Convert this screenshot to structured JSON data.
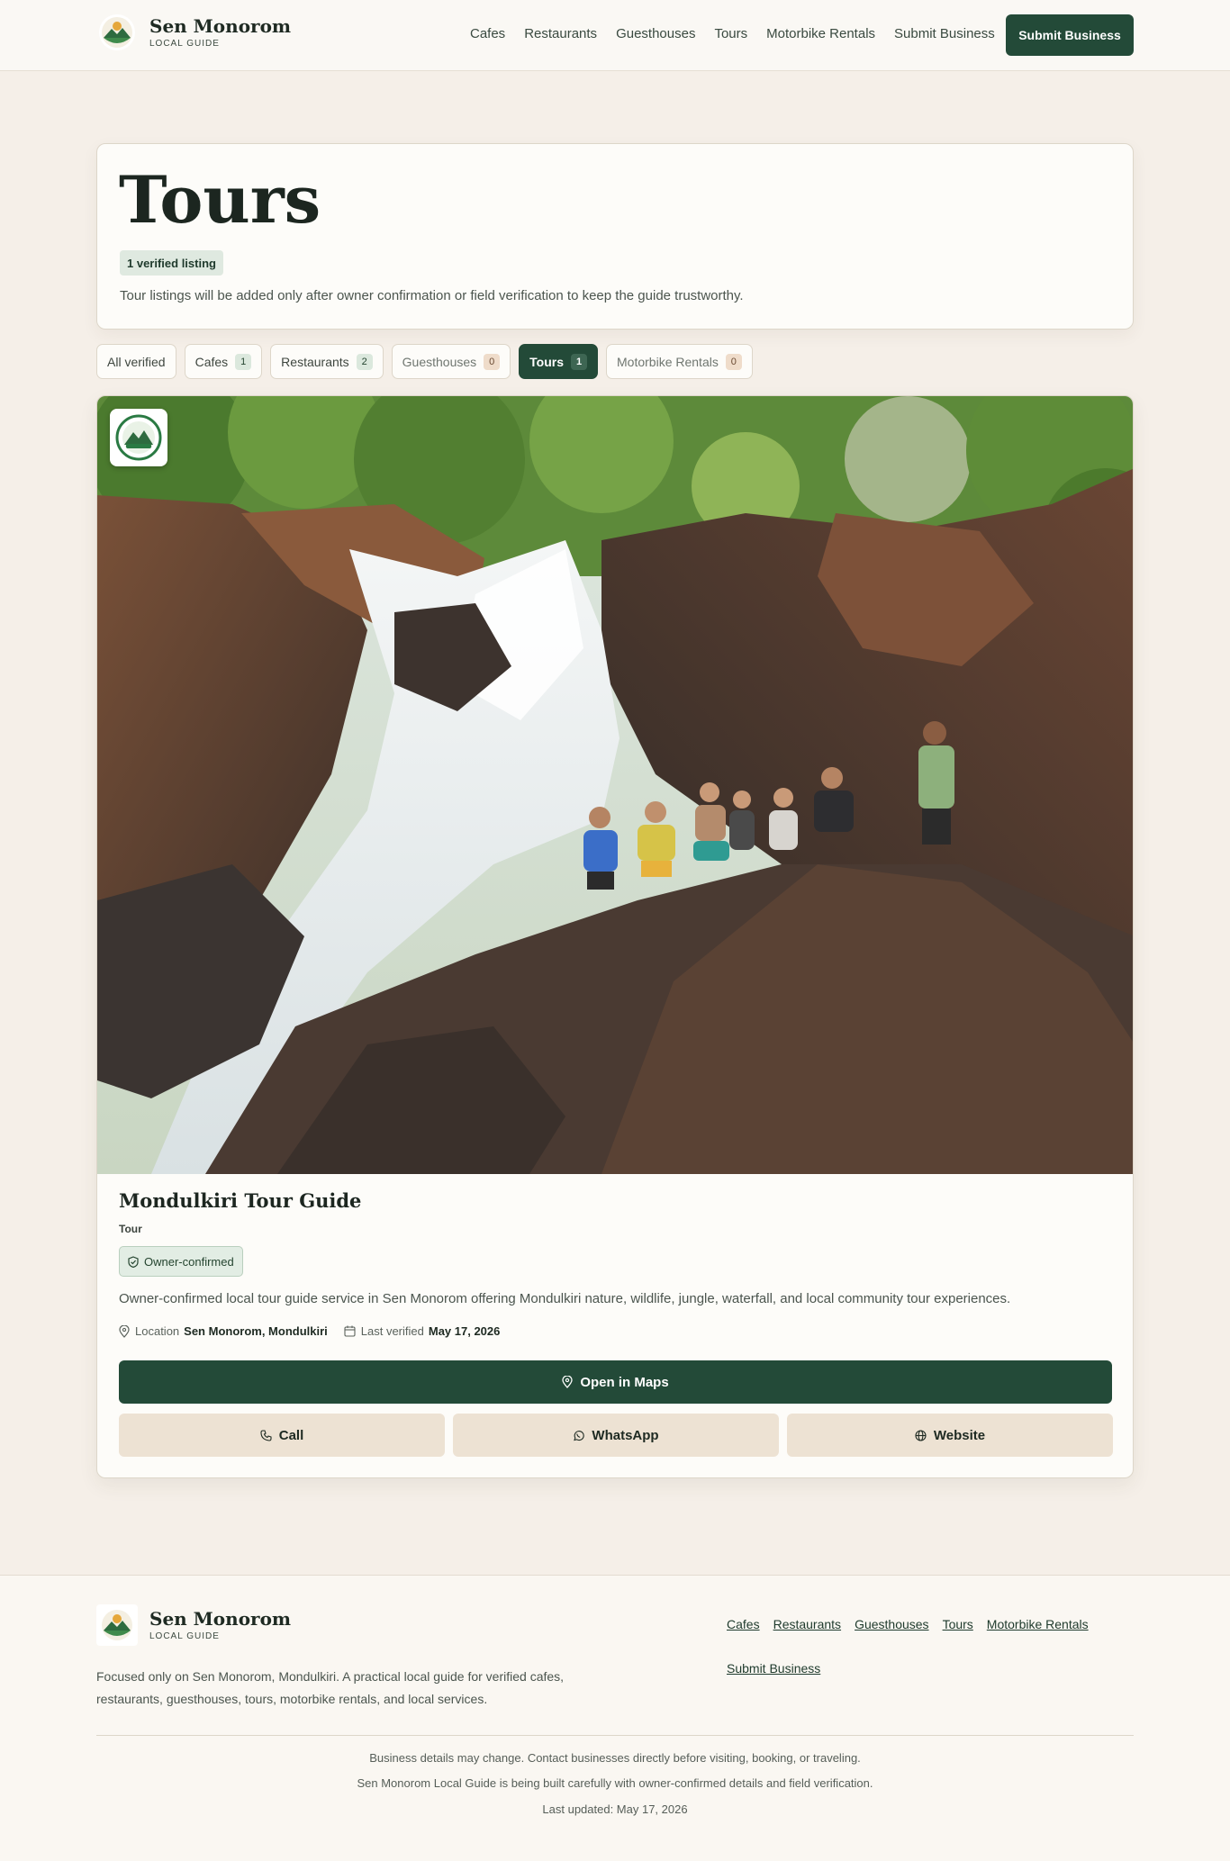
{
  "header": {
    "brand_name": "Sen Monorom",
    "brand_sub": "LOCAL GUIDE",
    "nav": [
      "Cafes",
      "Restaurants",
      "Guesthouses",
      "Tours",
      "Motorbike Rentals",
      "Submit Business"
    ],
    "submit_button": "Submit Business"
  },
  "hero": {
    "title": "Tours",
    "badge": "1 verified listing",
    "description": "Tour listings will be added only after owner confirmation or field verification to keep the guide trustworthy."
  },
  "filters": [
    {
      "label": "All verified",
      "count": null
    },
    {
      "label": "Cafes",
      "count": "1"
    },
    {
      "label": "Restaurants",
      "count": "2"
    },
    {
      "label": "Guesthouses",
      "count": "0"
    },
    {
      "label": "Tours",
      "count": "1"
    },
    {
      "label": "Motorbike Rentals",
      "count": "0"
    }
  ],
  "listing": {
    "title": "Mondulkiri Tour Guide",
    "type": "Tour",
    "badge": "Owner-confirmed",
    "description": "Owner-confirmed local tour guide service in Sen Monorom offering Mondulkiri nature, wildlife, jungle, waterfall, and local community tour experiences.",
    "location_label": "Location",
    "location_value": "Sen Monorom, Mondulkiri",
    "verified_label": "Last verified",
    "verified_value": "May 17, 2026",
    "maps_button": "Open in Maps",
    "call_button": "Call",
    "whatsapp_button": "WhatsApp",
    "website_button": "Website"
  },
  "footer": {
    "brand_name": "Sen Monorom",
    "brand_sub": "LOCAL GUIDE",
    "description": "Focused only on Sen Monorom, Mondulkiri. A practical local guide for verified cafes, restaurants, guesthouses, tours, motorbike rentals, and local services.",
    "links": [
      "Cafes",
      "Restaurants",
      "Guesthouses",
      "Tours",
      "Motorbike Rentals",
      "Submit Business"
    ],
    "note1": "Business details may change. Contact businesses directly before visiting, booking, or traveling.",
    "note2": "Sen Monorom Local Guide is being built carefully with owner-confirmed details and field verification.",
    "note3": "Last updated: May 17, 2026"
  },
  "colors": {
    "primary": "#234a38",
    "background": "#f5efe8",
    "card": "#fdfcf9",
    "secondary_button": "#ede2d3"
  }
}
